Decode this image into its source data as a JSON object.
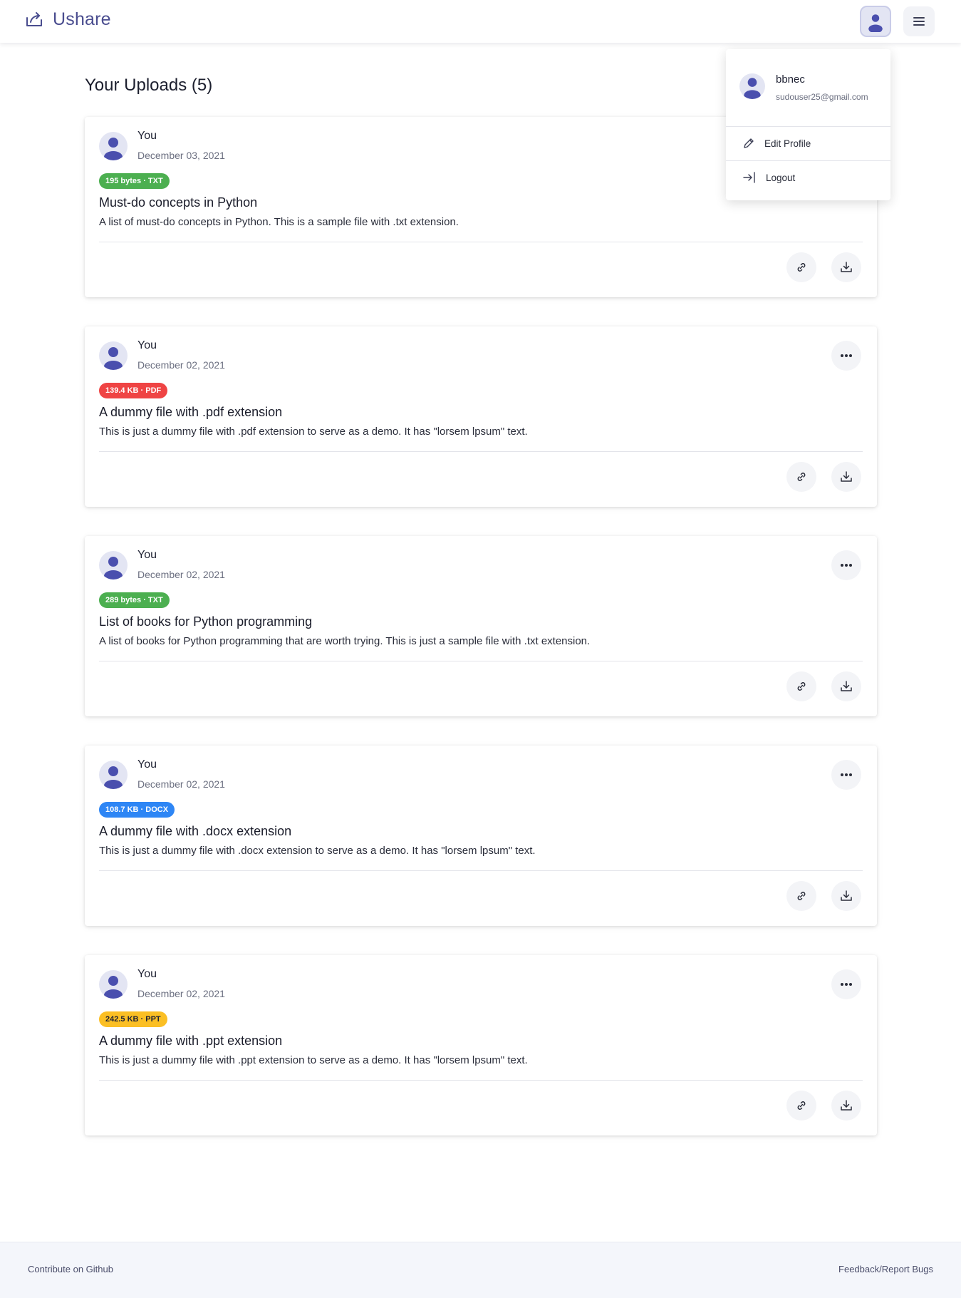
{
  "app": {
    "name": "Ushare"
  },
  "page": {
    "title": "Your Uploads (5)"
  },
  "user_menu": {
    "username": "bbnec",
    "email": "sudouser25@gmail.com",
    "items": [
      {
        "label": "Edit Profile",
        "icon": "pencil-icon"
      },
      {
        "label": "Logout",
        "icon": "logout-icon"
      }
    ]
  },
  "uploads": [
    {
      "owner": "You",
      "date": "December 03, 2021",
      "badge": "195 bytes · TXT",
      "badge_color": "#4caf50",
      "title": "Must-do concepts in Python",
      "description": "A list of must-do concepts in Python. This is a sample file with .txt extension."
    },
    {
      "owner": "You",
      "date": "December 02, 2021",
      "badge": "139.4 KB · PDF",
      "badge_color": "#ef4444",
      "title": "A dummy file with .pdf extension",
      "description": "This is just a dummy file with .pdf extension to serve as a demo. It has \"lorsem lpsum\" text."
    },
    {
      "owner": "You",
      "date": "December 02, 2021",
      "badge": "289 bytes · TXT",
      "badge_color": "#4caf50",
      "title": "List of books for Python programming",
      "description": "A list of books for Python programming that are worth trying. This is just a sample file with .txt extension."
    },
    {
      "owner": "You",
      "date": "December 02, 2021",
      "badge": "108.7 KB · DOCX",
      "badge_color": "#2e86f5",
      "title": "A dummy file with .docx extension",
      "description": "This is just a dummy file with .docx extension to serve as a demo. It has \"lorsem lpsum\" text."
    },
    {
      "owner": "You",
      "date": "December 02, 2021",
      "badge": "242.5 KB · PPT",
      "badge_color": "#fbbf24",
      "badge_text_color": "#1f2233",
      "title": "A dummy file with .ppt extension",
      "description": "This is just a dummy file with .ppt extension to serve as a demo. It has \"lorsem lpsum\" text."
    }
  ],
  "footer": {
    "left_link": "Contribute on Github",
    "right_link": "Feedback/Report Bugs"
  },
  "colors": {
    "brand": "#4a4d8f",
    "avatar_figure": "#4a4fae"
  }
}
